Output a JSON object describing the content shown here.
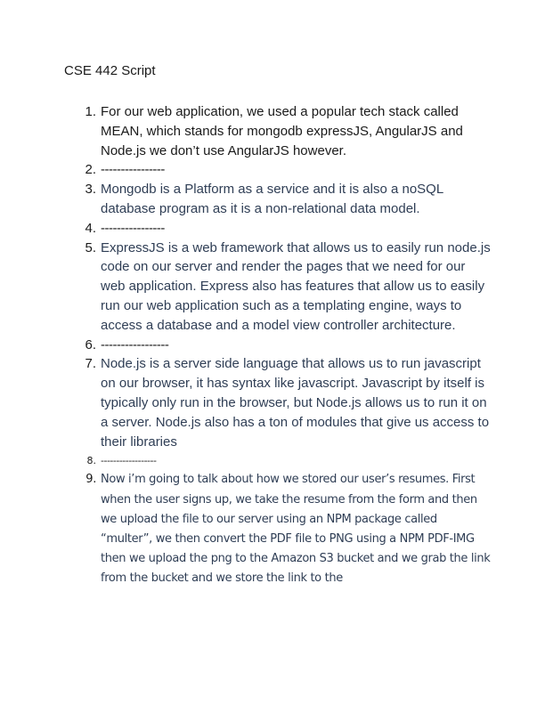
{
  "document": {
    "title": "CSE 442 Script",
    "items": [
      {
        "number": "1.",
        "text": "For our web application, we used a popular tech stack called MEAN, which stands for mongodb expressJS, AngularJS and Node.js we don’t use AngularJS however."
      },
      {
        "number": "2.",
        "text": "----------------"
      },
      {
        "number": "3.",
        "text": "Mongodb is a Platform as a service and it is also a noSQL database program as it is a non-relational data model."
      },
      {
        "number": "4.",
        "text": "----------------"
      },
      {
        "number": "5.",
        "text": "ExpressJS is a web framework that allows us to easily run node.js code on our server and render the pages that we need for our web application. Express also has features that allow us to easily run our web application such as a templating engine, ways to access a database and a model view controller architecture."
      },
      {
        "number": "6.",
        "text": "-----------------"
      },
      {
        "number": "7.",
        "text": "Node.js is a server side language that allows us to run javascript on our browser, it has syntax like javascript. Javascript by itself is typically only run in the browser, but Node.js allows us to run it on a server. Node.js also has a ton of modules that give us access to their libraries"
      },
      {
        "number": "8.",
        "text": "------------------"
      },
      {
        "number": "9.",
        "text": "Now i’m going to talk about how we stored our user’s resumes. First when the user signs up, we take the resume from the form and then we upload the file to our server using an NPM package called “multer”, we then convert the PDF file to PNG using a NPM PDF-IMG then we upload the png to the Amazon S3 bucket and we grab the link from the bucket and we store the link to the"
      }
    ]
  }
}
